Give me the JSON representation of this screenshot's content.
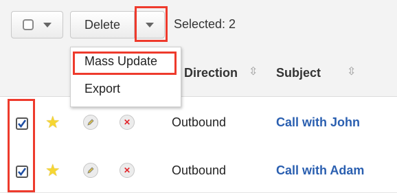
{
  "toolbar": {
    "delete_label": "Delete",
    "selected_text": "Selected: 2"
  },
  "menu": {
    "items": [
      {
        "label": "Mass Update",
        "highlighted": true
      },
      {
        "label": "Export",
        "highlighted": false
      }
    ]
  },
  "table": {
    "columns": [
      "Direction",
      "Subject"
    ],
    "rows": [
      {
        "checked": true,
        "favorite_icon": "star-icon",
        "direction": "Outbound",
        "subject": "Call with John"
      },
      {
        "checked": true,
        "favorite_icon": "star-icon",
        "direction": "Outbound",
        "subject": "Call with Adam"
      }
    ]
  },
  "colors": {
    "highlight": "#ee3a2c",
    "link": "#2a5fb0",
    "star": "#f6d632",
    "remove": "#e2252b"
  }
}
